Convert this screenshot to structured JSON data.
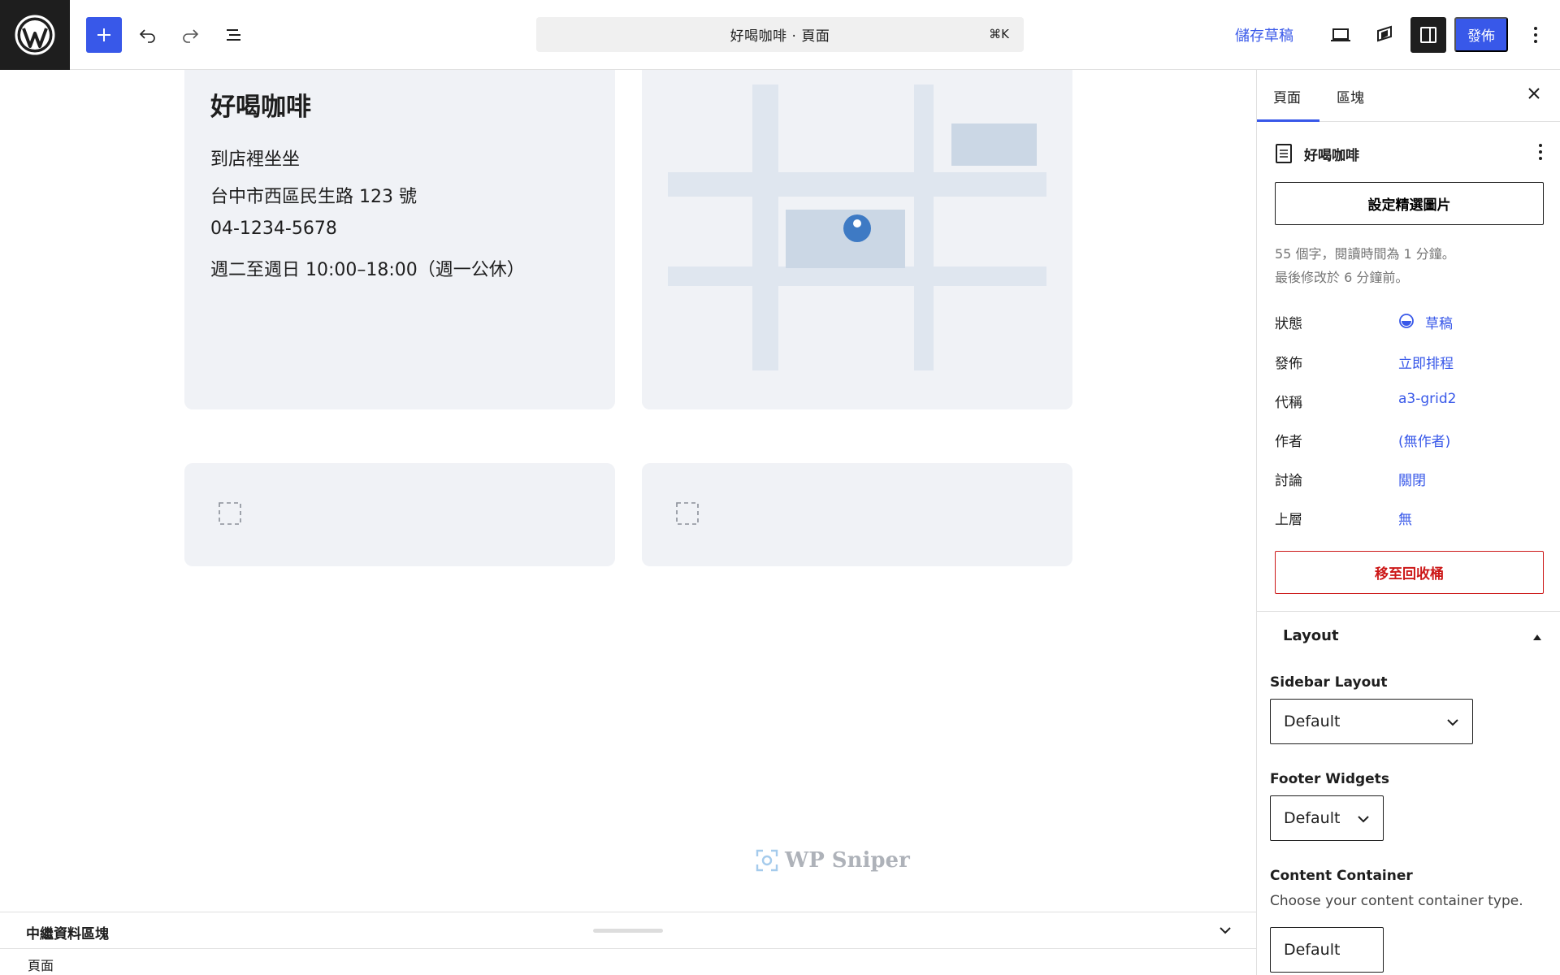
{
  "toolbar": {
    "document_title": "好喝咖啡 · 頁面",
    "shortcut": "⌘K",
    "save_draft": "儲存草稿",
    "publish": "發佈"
  },
  "canvas": {
    "info_card": {
      "title": "好喝咖啡",
      "lines": [
        "到店裡坐坐",
        "台中市西區民生路 123 號",
        "04-1234-5678",
        "週二至週日 10:00–18:00（週一公休）"
      ]
    },
    "watermark": "WP Sniper"
  },
  "meta_panel": {
    "label": "中繼資料區塊"
  },
  "breadcrumb": {
    "label": "頁面"
  },
  "sidebar": {
    "tabs": {
      "page": "頁面",
      "block": "區塊"
    },
    "document": {
      "title": "好喝咖啡"
    },
    "featured_image_button": "設定精選圖片",
    "stats": {
      "words": "55 個字，閱讀時間為 1 分鐘。",
      "modified": "最後修改於 6 分鐘前。"
    },
    "rows": [
      {
        "key": "狀態",
        "value": "草稿"
      },
      {
        "key": "發佈",
        "value": "立即排程"
      },
      {
        "key": "代稱",
        "value": "a3-grid2"
      },
      {
        "key": "作者",
        "value": "(無作者)"
      },
      {
        "key": "討論",
        "value": "關閉"
      },
      {
        "key": "上層",
        "value": "無"
      }
    ],
    "trash_button": "移至回收桶",
    "layout": {
      "title": "Layout",
      "sidebar_layout": {
        "label": "Sidebar Layout",
        "value": "Default"
      },
      "footer_widgets": {
        "label": "Footer Widgets",
        "value": "Default"
      },
      "content_container": {
        "label": "Content Container",
        "help": "Choose your content container type.",
        "value": "Default"
      }
    }
  },
  "colors": {
    "accent": "#3858e9",
    "danger": "#cc1818",
    "card_bg": "#f0f2f6",
    "dark": "#1e1e1e"
  }
}
